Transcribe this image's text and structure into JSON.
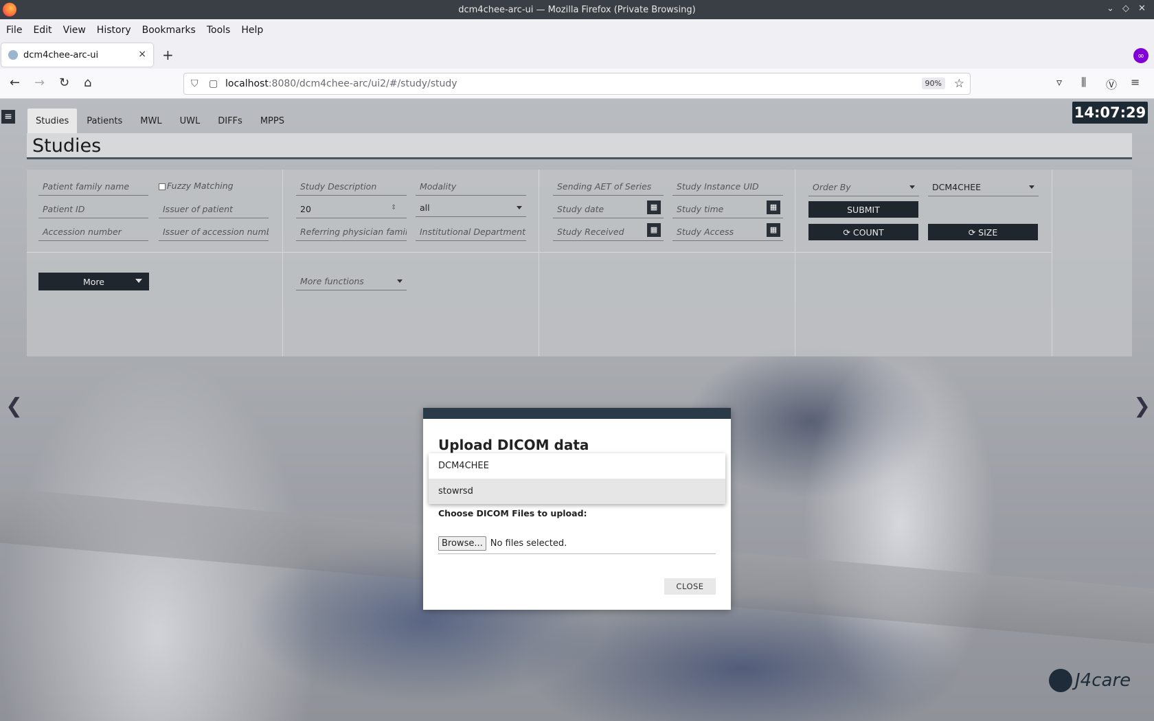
{
  "window": {
    "title": "dcm4chee-arc-ui — Mozilla Firefox (Private Browsing)"
  },
  "menu": [
    "File",
    "Edit",
    "View",
    "History",
    "Bookmarks",
    "Tools",
    "Help"
  ],
  "browser_tab": {
    "label": "dcm4chee-arc-ui",
    "close": "×",
    "new_tab": "+"
  },
  "url": {
    "host": "localhost",
    "rest": ":8080/dcm4chee-arc/ui2/#/study/study",
    "zoom": "90%"
  },
  "clock": "14:07:29",
  "app_tabs": [
    "Studies",
    "Patients",
    "MWL",
    "UWL",
    "DIFFs",
    "MPPS"
  ],
  "page_title": "Studies",
  "filters": {
    "patient_family_name": "Patient family name",
    "fuzzy_matching": "Fuzzy Matching",
    "patient_id": "Patient ID",
    "issuer_of_patient": "Issuer of patient",
    "accession_number": "Accession number",
    "issuer_of_accession": "Issuer of accession numbe",
    "study_description": "Study Description",
    "modality": "Modality",
    "limit_value": "20",
    "modality_value": "all",
    "referring_physician": "Referring physician family",
    "institutional_department": "Institutional Department N",
    "sending_aet": "Sending AET of Series",
    "study_instance_uid": "Study Instance UID",
    "study_date": "Study date",
    "study_time": "Study time",
    "study_received": "Study Received",
    "study_access": "Study Access",
    "order_by": "Order By",
    "aet": "DCM4CHEE",
    "submit": "SUBMIT",
    "count": "COUNT",
    "size": "SIZE",
    "more": "More",
    "more_functions": "More functions"
  },
  "modal": {
    "title": "Upload DICOM data",
    "options": [
      "DCM4CHEE",
      "stowrsd"
    ],
    "selected_option": "stowrsd",
    "choose_label": "Choose DICOM Files to upload:",
    "browse": "Browse...",
    "no_files": "No files selected.",
    "close": "CLOSE"
  },
  "brand": "J4care"
}
